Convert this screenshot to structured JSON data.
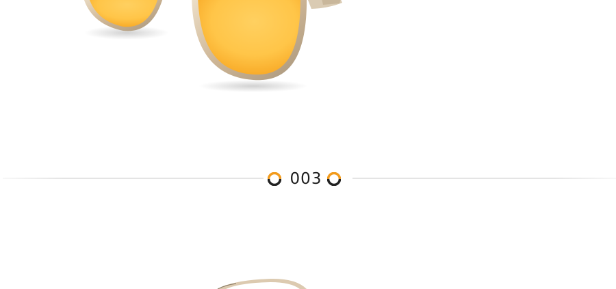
{
  "section": {
    "number": "003"
  },
  "colors": {
    "ring_accent": "#f29b1d",
    "ring_dark": "#222222",
    "lens_yellow": "#ffc84a",
    "lens_orange": "#f7a21b",
    "frame_gold": "#d8c3a5",
    "divider": "#e4e4e4"
  },
  "icons": {
    "left_marker": "half-ring-icon",
    "right_marker": "half-ring-icon"
  }
}
